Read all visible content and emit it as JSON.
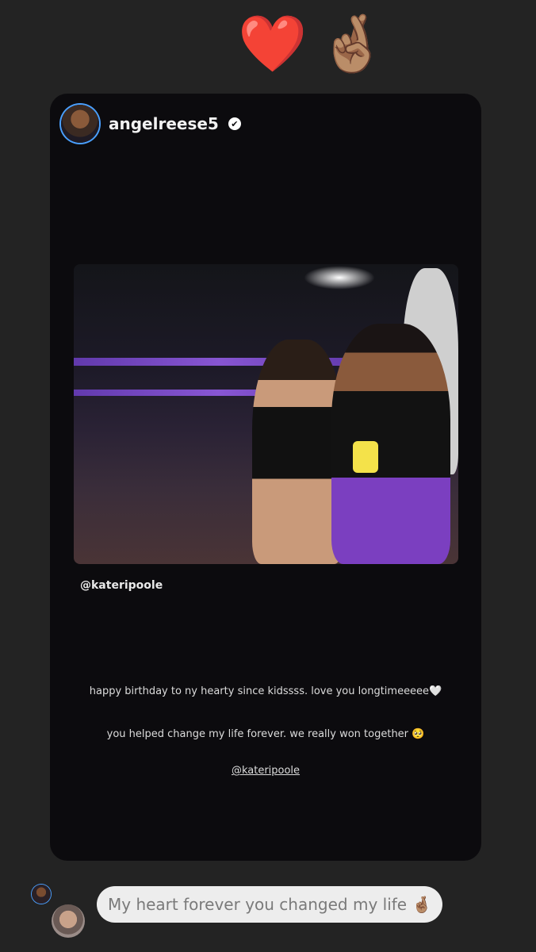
{
  "reactions": {
    "heart": "❤️",
    "fingers_crossed": "🤞🏽"
  },
  "story": {
    "username": "angelreese5",
    "verified_mark": "✔",
    "photo_tag": "@kateripoole",
    "caption_line1": "happy birthday to ny hearty since kidssss. love you longtimeeeee🤍",
    "caption_line2": "you helped change my life forever. we really won together 🥺",
    "caption_mention": "@kateripoole"
  },
  "reply": {
    "message": "My heart forever you changed my life 🤞🏽"
  },
  "colors": {
    "background": "#232323",
    "card": "#0c0b0e",
    "bubble": "#ededed"
  }
}
